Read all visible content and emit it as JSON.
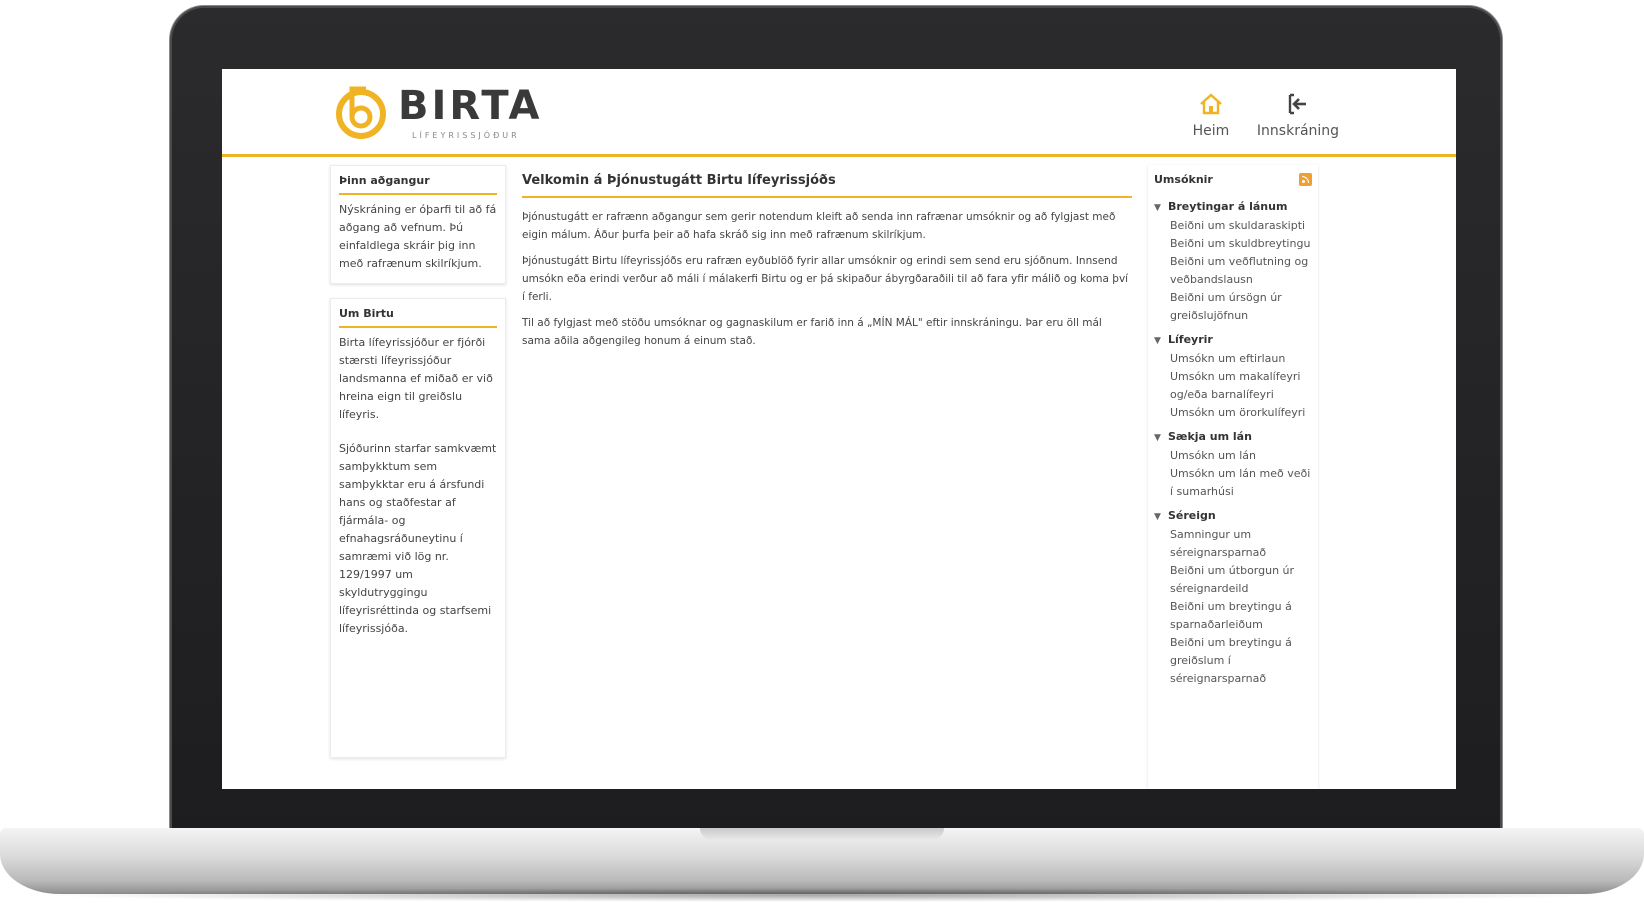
{
  "header": {
    "logo_text": "BIRTA",
    "logo_sub": "LÍFEYRISSJÓÐUR",
    "nav": {
      "home_label": "Heim",
      "login_label": "Innskráning"
    }
  },
  "colors": {
    "accent": "#f0b323",
    "rss": "#f0a030"
  },
  "left": {
    "box1": {
      "title": "Þinn aðgangur",
      "text": "Nýskráning er óþarfi til að fá aðgang að vefnum. Þú einfaldlega skráir þig inn með rafrænum skilríkjum."
    },
    "box2": {
      "title": "Um Birtu",
      "p1": "Birta lífeyrissjóður er fjórði stærsti lífeyrissjóður landsmanna ef miðað er við hreina eign til greiðslu lífeyris.",
      "p2": "Sjóðurinn starfar samkvæmt samþykktum sem samþykktar eru á ársfundi hans og staðfestar af fjármála- og efnahagsráðuneytinu í samræmi við lög nr. 129/1997 um skyldutryggingu lífeyrisréttinda og starfsemi lífeyrissjóða."
    }
  },
  "main": {
    "title": "Velkomin á Þjónustugátt Birtu lífeyrissjóðs",
    "p1": "Þjónustugátt er rafrænn aðgangur sem gerir notendum kleift að senda inn rafrænar umsóknir og að fylgjast með eigin málum. Áður þurfa þeir að hafa skráð sig inn með rafrænum skilríkjum.",
    "p2": "Þjónustugátt Birtu lífeyrissjóðs eru rafræn eyðublöð fyrir allar umsóknir og erindi sem send eru sjóðnum. Innsend umsókn eða erindi verður að máli í málakerfi Birtu og er þá skipaður ábyrgðaraðili til að fara yfir málið og koma því í ferli.",
    "p3": "Til að fylgjast með stöðu umsóknar og gagnaskilum er farið inn á „MÍN MÁL\" eftir innskráningu. Þar eru öll mál sama aðila aðgengileg honum á einum stað."
  },
  "right": {
    "title": "Umsóknir",
    "categories": [
      {
        "label": "Breytingar á lánum",
        "items": [
          "Beiðni um skuldaraskipti",
          "Beiðni um skuldbreytingu",
          "Beiðni um veðflutning og veðbandslausn",
          "Beiðni um úrsögn úr greiðslujöfnun"
        ]
      },
      {
        "label": "Lífeyrir",
        "items": [
          "Umsókn um eftirlaun",
          "Umsókn um makalífeyri og/eða barnalífeyri",
          "Umsókn um örorkulífeyri"
        ]
      },
      {
        "label": "Sækja um lán",
        "items": [
          "Umsókn um lán",
          "Umsókn um lán með veði í sumarhúsi"
        ]
      },
      {
        "label": "Séreign",
        "items": [
          "Samningur um séreignarsparnað",
          "Beiðni um útborgun úr séreignardeild",
          "Beiðni um breytingu á sparnaðarleiðum",
          "Beiðni um breytingu á greiðslum í séreignarsparnað"
        ]
      }
    ]
  }
}
